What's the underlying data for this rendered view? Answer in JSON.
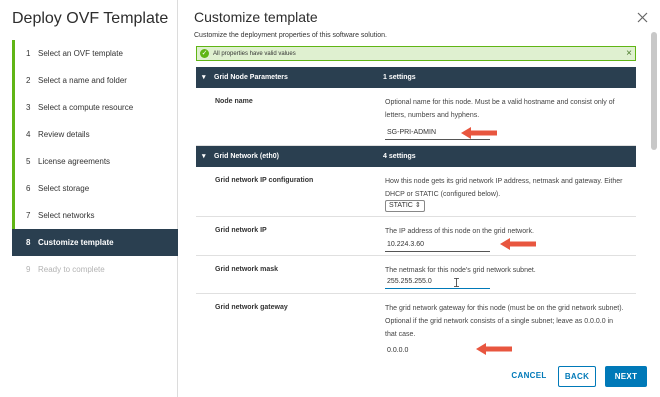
{
  "wizard": {
    "title": "Deploy OVF Template",
    "steps": [
      {
        "num": "1",
        "label": "Select an OVF template"
      },
      {
        "num": "2",
        "label": "Select a name and folder"
      },
      {
        "num": "3",
        "label": "Select a compute resource"
      },
      {
        "num": "4",
        "label": "Review details"
      },
      {
        "num": "5",
        "label": "License agreements"
      },
      {
        "num": "6",
        "label": "Select storage"
      },
      {
        "num": "7",
        "label": "Select networks"
      },
      {
        "num": "8",
        "label": "Customize template"
      },
      {
        "num": "9",
        "label": "Ready to complete"
      }
    ]
  },
  "main": {
    "title": "Customize template",
    "subtitle": "Customize the deployment properties of this software solution.",
    "alert": "All properties have valid values",
    "sections": [
      {
        "name": "Grid Node Parameters",
        "count": "1 settings",
        "rows": [
          {
            "label": "Node name",
            "desc": "Optional name for this node. Must be a valid hostname and consist only of letters, numbers and hyphens.",
            "value": "SG-PRI-ADMIN"
          }
        ]
      },
      {
        "name": "Grid Network (eth0)",
        "count": "4 settings",
        "rows": [
          {
            "label": "Grid network IP configuration",
            "desc": "How this node gets its grid network IP address, netmask and gateway. Either DHCP or STATIC (configured below).",
            "value": "STATIC"
          },
          {
            "label": "Grid network IP",
            "desc": "The IP address of this node on the grid network.",
            "value": "10.224.3.60"
          },
          {
            "label": "Grid network mask",
            "desc": "The netmask for this node's grid network subnet.",
            "value": "255.255.255.0"
          },
          {
            "label": "Grid network gateway",
            "desc": "The grid network gateway for this node (must be on the grid network subnet). Optional if the grid network consists of a single subnet; leave as 0.0.0.0 in that case.",
            "value": "0.0.0.0"
          }
        ]
      }
    ]
  },
  "footer": {
    "cancel": "CANCEL",
    "back": "BACK",
    "next": "NEXT"
  },
  "colors": {
    "accent": "#0079b8",
    "section_header": "#2a3f50",
    "valid_green": "#60b515",
    "arrow": "#e8563f"
  },
  "icons": {
    "close": "close-icon",
    "alert": "check-circle-icon",
    "section": "chevron-down-icon",
    "select": "select-arrows-icon"
  }
}
